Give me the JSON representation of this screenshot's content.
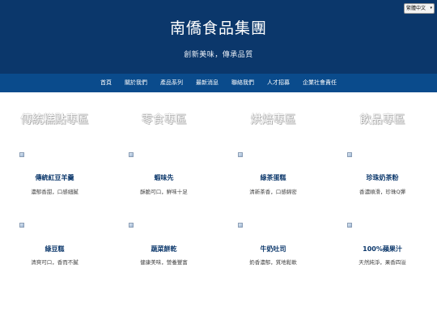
{
  "language_select": {
    "value": "繁體中文"
  },
  "header": {
    "title": "南僑食品集團",
    "tagline": "創新美味，傳承品質"
  },
  "nav": {
    "items": [
      "首頁",
      "關於我們",
      "產品系列",
      "最新消息",
      "聯絡我們",
      "人才招募",
      "企業社會責任"
    ]
  },
  "sections": [
    "傳統糕點專區",
    "零食專區",
    "烘焙專區",
    "飲品專區"
  ],
  "products": [
    {
      "name": "傳統紅豆羊羹",
      "desc": "濃郁香甜，口感細膩"
    },
    {
      "name": "蝦味先",
      "desc": "酥脆可口，鮮味十足"
    },
    {
      "name": "綠茶蛋糕",
      "desc": "清新茶香，口感綿密"
    },
    {
      "name": "珍珠奶茶粉",
      "desc": "香濃順滑，珍珠Q彈"
    },
    {
      "name": "綠豆糕",
      "desc": "清爽可口，香而不膩"
    },
    {
      "name": "蔬菜餅乾",
      "desc": "健康美味，營養豐富"
    },
    {
      "name": "牛奶吐司",
      "desc": "奶香濃郁，質地鬆軟"
    },
    {
      "name": "100%蘋果汁",
      "desc": "天然純淨，果香四溢"
    }
  ],
  "colors": {
    "header_bg": "#0b376b",
    "nav_bg": "#0a4b8c",
    "product_name": "#0b376b"
  },
  "icons": {
    "product_image": "broken-image-icon",
    "select_caret": "chevron-down-icon"
  }
}
